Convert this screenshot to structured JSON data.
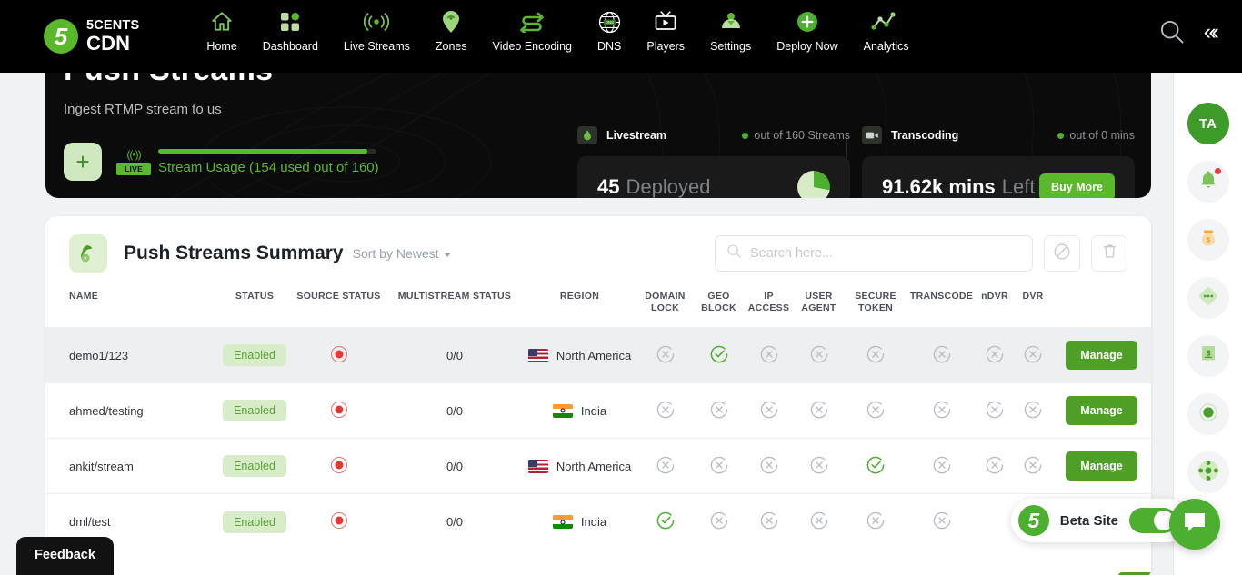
{
  "brand": {
    "logo_char": "5",
    "line1": "5CENTS",
    "line2": "CDN"
  },
  "nav": {
    "items": [
      {
        "label": "Home",
        "icon": "home-icon"
      },
      {
        "label": "Dashboard",
        "icon": "grid-icon"
      },
      {
        "label": "Live Streams",
        "icon": "broadcast-icon"
      },
      {
        "label": "Zones",
        "icon": "map-pin-wifi-icon"
      },
      {
        "label": "Video Encoding",
        "icon": "transcode-arrows-icon"
      },
      {
        "label": "DNS",
        "icon": "globe-dns-icon"
      },
      {
        "label": "Players",
        "icon": "tv-play-icon"
      },
      {
        "label": "Settings",
        "icon": "user-settings-icon"
      },
      {
        "label": "Deploy Now",
        "icon": "plus-circle-icon"
      },
      {
        "label": "Analytics",
        "icon": "line-chart-icon"
      }
    ],
    "search_icon": "search-icon",
    "collapse_icon": "double-chevron-left-icon",
    "collapse_glyph": "«‹"
  },
  "hero": {
    "title": "Push Streams",
    "subtitle": "Ingest RTMP stream to us",
    "add_label": "+",
    "live_tag": "LIVE",
    "live_wave": "((•))",
    "usage_text": "Stream Usage (154 used out of 160)",
    "usage_percent": 96,
    "accent": "#5cb82b"
  },
  "stats": [
    {
      "name": "Livestream",
      "icon": "livestream-icon",
      "out_of": "out of 160 Streams",
      "value": "45",
      "unit": "Deployed",
      "chart": "pie-chart",
      "pie_percent": 28
    },
    {
      "name": "Transcoding",
      "icon": "video-camera-icon",
      "out_of": "out of 0 mins",
      "value": "91.62k mins",
      "unit": "Left",
      "action_label": "Buy More"
    }
  ],
  "summary": {
    "icon": "push-stream-icon",
    "title": "Push Streams Summary",
    "sort_label": "Sort by Newest",
    "search": {
      "placeholder": "Search here...",
      "value": "",
      "icon": "search-icon"
    },
    "disable_icon": "no-entry-icon",
    "delete_icon": "trash-icon",
    "columns": [
      "NAME",
      "STATUS",
      "SOURCE STATUS",
      "MULTISTREAM STATUS",
      "REGION",
      "DOMAIN LOCK",
      "GEO BLOCK",
      "IP ACCESS",
      "USER AGENT",
      "SECURE TOKEN",
      "TRANSCODE",
      "nDVR",
      "DVR",
      ""
    ],
    "rows": [
      {
        "name": "demo1/123",
        "status": "Enabled",
        "source_status": "recording-dot",
        "multistream": "0/0",
        "region": "North America",
        "flag": "us",
        "domain_lock": false,
        "geo_block": true,
        "ip_access": false,
        "user_agent": false,
        "secure_token": false,
        "transcode": false,
        "ndvr": false,
        "dvr": false,
        "action": "Manage"
      },
      {
        "name": "ahmed/testing",
        "status": "Enabled",
        "source_status": "recording-dot",
        "multistream": "0/0",
        "region": "India",
        "flag": "in",
        "domain_lock": false,
        "geo_block": false,
        "ip_access": false,
        "user_agent": false,
        "secure_token": false,
        "transcode": false,
        "ndvr": false,
        "dvr": false,
        "action": "Manage"
      },
      {
        "name": "ankit/stream",
        "status": "Enabled",
        "source_status": "recording-dot",
        "multistream": "0/0",
        "region": "North America",
        "flag": "us",
        "domain_lock": false,
        "geo_block": false,
        "ip_access": false,
        "user_agent": false,
        "secure_token": true,
        "transcode": false,
        "ndvr": false,
        "dvr": false,
        "action": "Manage"
      },
      {
        "name": "dml/test",
        "status": "Enabled",
        "source_status": "recording-dot",
        "multistream": "0/0",
        "region": "India",
        "flag": "in",
        "domain_lock": true,
        "geo_block": false,
        "ip_access": false,
        "user_agent": false,
        "secure_token": false,
        "transcode": false,
        "ndvr": null,
        "dvr": null,
        "action": ""
      }
    ]
  },
  "rail": [
    {
      "name": "avatar",
      "label": "TA",
      "icon": "avatar"
    },
    {
      "name": "notifications",
      "label": "",
      "icon": "bell-icon"
    },
    {
      "name": "billing",
      "label": "",
      "icon": "money-bag-icon"
    },
    {
      "name": "more",
      "label": "",
      "icon": "more-diamond-icon"
    },
    {
      "name": "invoices",
      "label": "",
      "icon": "receipt-dollar-icon"
    },
    {
      "name": "status",
      "label": "",
      "icon": "target-dot-icon"
    },
    {
      "name": "support",
      "label": "",
      "icon": "hub-icon"
    }
  ],
  "floating": {
    "beta_logo": "5",
    "beta_label": "Beta Site",
    "beta_enabled": true,
    "chat_icon": "chat-bubble-icon",
    "feedback_label": "Feedback"
  }
}
